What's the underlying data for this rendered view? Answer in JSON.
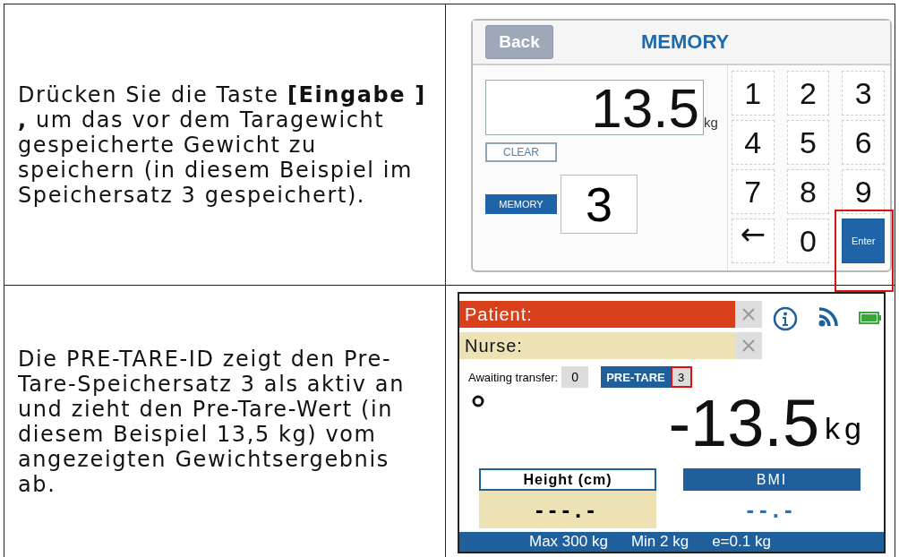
{
  "instructions": [
    {
      "text": "Drücken Sie die Taste **[Eingabe ] ,** um das vor dem Taragewicht gespeicherte Gewicht zu speichern (in diesem Beispiel im Speichersatz 3 gespeichert)."
    },
    {
      "text": "Die PRE-TARE-ID zeigt den Pre-Tare-Speichersatz 3 als aktiv an und zieht den Pre-Tare-Wert (in diesem Beispiel 13,5 kg) vom angezeigten Gewichtsergebnis ab."
    }
  ],
  "memory_screen": {
    "back": "Back",
    "title": "MEMORY",
    "weight": "13.5",
    "unit": "kg",
    "clear": "CLEAR",
    "memory_label": "MEMORY",
    "memory_value": "3",
    "keys": [
      {
        "label": "1",
        "kind": "digit",
        "highlighted": false
      },
      {
        "label": "2",
        "kind": "digit",
        "highlighted": false
      },
      {
        "label": "3",
        "kind": "digit",
        "highlighted": false
      },
      {
        "label": "4",
        "kind": "digit",
        "highlighted": false
      },
      {
        "label": "5",
        "kind": "digit",
        "highlighted": false
      },
      {
        "label": "6",
        "kind": "digit",
        "highlighted": false
      },
      {
        "label": "7",
        "kind": "digit",
        "highlighted": false
      },
      {
        "label": "8",
        "kind": "digit",
        "highlighted": false
      },
      {
        "label": "9",
        "kind": "digit",
        "highlighted": false
      },
      {
        "label": "←",
        "kind": "backspace",
        "highlighted": false
      },
      {
        "label": "0",
        "kind": "digit",
        "highlighted": false
      },
      {
        "label": "Enter",
        "kind": "enter",
        "highlighted": true
      }
    ]
  },
  "scale_screen": {
    "patient_label": "Patient:",
    "nurse_label": "Nurse:",
    "awaiting_label": "Awaiting transfer:",
    "awaiting_value": "0",
    "pretare_label": "PRE-TARE",
    "pretare_value": "3",
    "pretare_highlighted": true,
    "weight": "-13.5",
    "unit": "kg",
    "height_label": "Height (cm)",
    "height_value": "---.-",
    "bmi_label": "BMI",
    "bmi_value": "--.-",
    "footer": [
      "Max 300 kg",
      "Min 2 kg",
      "e=0.1 kg"
    ]
  }
}
